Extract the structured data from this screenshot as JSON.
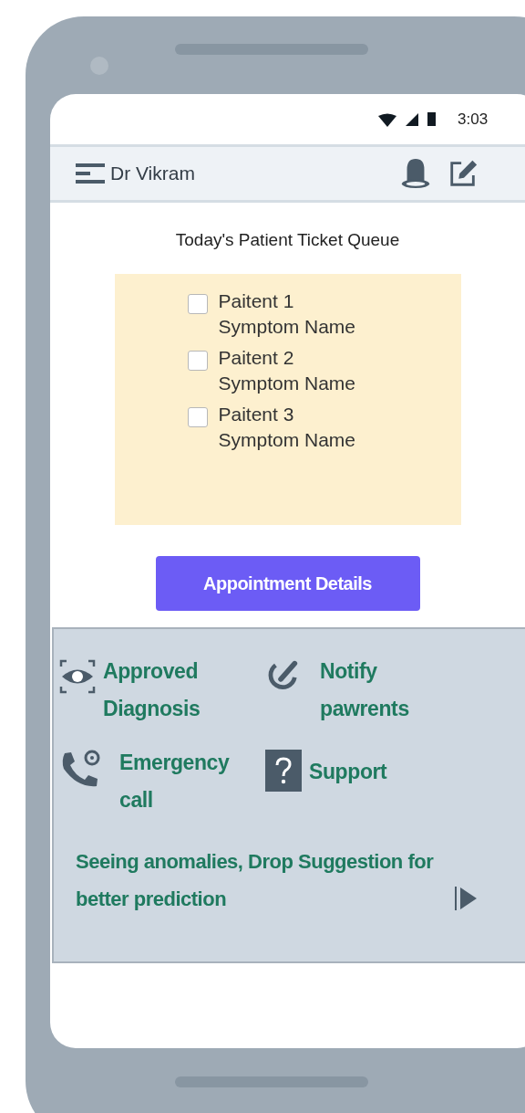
{
  "status_bar": {
    "time": "3:03"
  },
  "header": {
    "title": "Dr Vikram"
  },
  "queue": {
    "title": "Today's Patient Ticket Queue",
    "patients": [
      {
        "name": "Paitent 1",
        "symptom": "Symptom Name",
        "checked": false
      },
      {
        "name": "Paitent 2",
        "symptom": "Symptom Name",
        "checked": false
      },
      {
        "name": "Paitent 3",
        "symptom": "Symptom Name",
        "checked": false
      }
    ]
  },
  "button": {
    "label": "Appointment Details"
  },
  "actions": [
    {
      "kind": "eye",
      "label": "Approved Diagnosis"
    },
    {
      "kind": "check",
      "label": "Notify pawrents"
    },
    {
      "kind": "phone",
      "label": "Emergency call"
    },
    {
      "kind": "help",
      "label": "Support"
    }
  ],
  "suggestion": {
    "text": "Seeing anomalies, Drop Suggestion for better prediction"
  }
}
